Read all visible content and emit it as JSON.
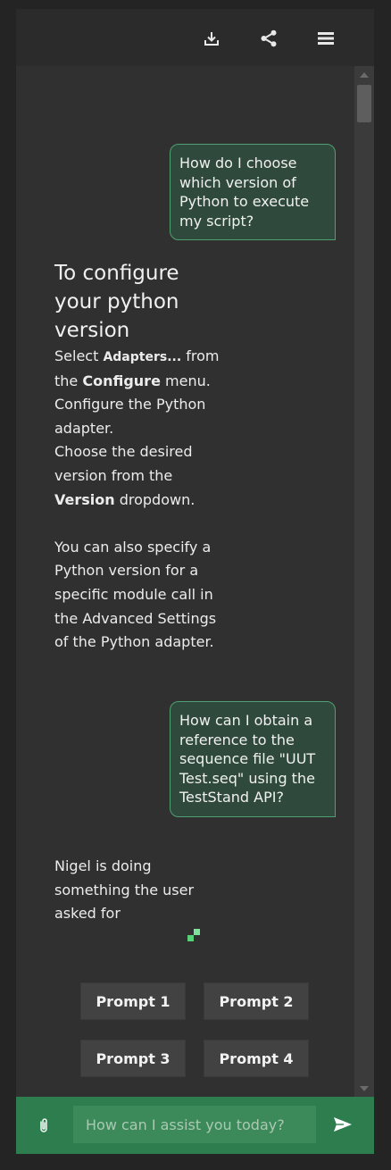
{
  "toolbar": {
    "download_icon": "download-icon",
    "share_icon": "share-icon",
    "menu_icon": "hamburger-menu-icon"
  },
  "messages": {
    "user1": "How do I choose which version of Python to execute my script?",
    "answer1": {
      "heading": "To configure your python version",
      "p1_a": "Select ",
      "p1_b": "Adapters...",
      "p1_c": " from the ",
      "p1_d": "Configure",
      "p1_e": " menu.",
      "p2": "Configure the Python adapter.",
      "p3_a": "Choose the desired version from the ",
      "p3_b": "Version",
      "p3_c": " dropdown.",
      "p4": "You can also specify a Python version for a specific module call in the Advanced Settings of the Python adapter."
    },
    "user2": "How can I obtain a reference to the sequence file \"UUT Test.seq\" using the TestStand API?",
    "status": "Nigel is doing something the user asked for"
  },
  "prompts": [
    "Prompt 1",
    "Prompt 2",
    "Prompt 3",
    "Prompt 4"
  ],
  "input": {
    "placeholder": "How can I assist you today?",
    "value": ""
  },
  "colors": {
    "accent": "#2e7d4f",
    "bubble_bg": "#2f4a3c",
    "bubble_border": "#4fa070",
    "loader": "#57d07a"
  }
}
